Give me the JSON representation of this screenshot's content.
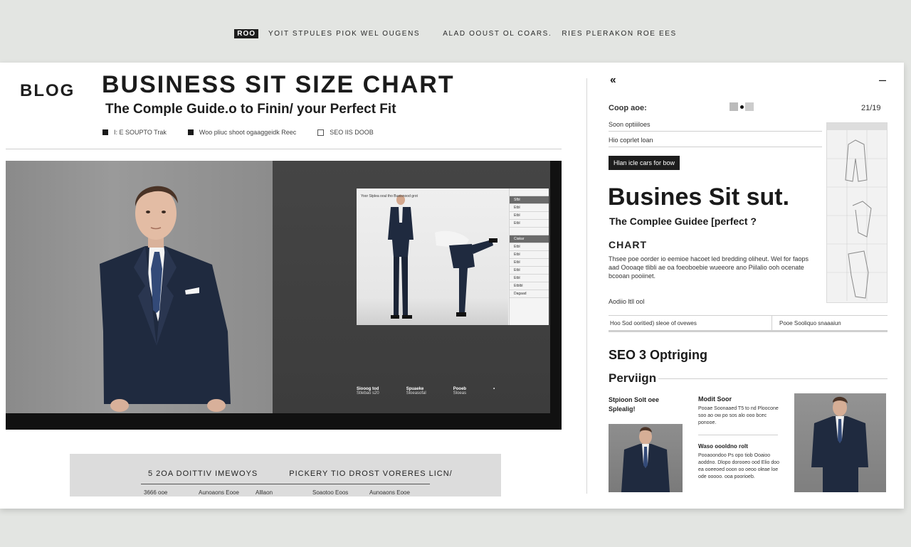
{
  "topbar": {
    "tag": "ROO",
    "nav_1": "YOIT STPULES PIOK WEL OUGENS",
    "nav_2": "ALAD OOUST OL COARS.",
    "nav_3": "RIES PLERAKON ROE EES"
  },
  "header": {
    "blog_label": "BLOG",
    "title": "BUSINESS SIT SIZE CHART",
    "subtitle": "The Comple Guide.o to Finin/ your Perfect Fit",
    "meta": [
      "I: E SOUPTO Trak",
      "Woo pliuc shoot ogaaggeidk Reec",
      "SEO IIS DOOB"
    ]
  },
  "hero": {
    "inset_caption": "Yoor Stplea ooul tho Bueisnood grot",
    "inset_table_rows": [
      {
        "label": "",
        "head": false
      },
      {
        "label": "Sfbl",
        "head": true
      },
      {
        "label": "Etbl",
        "head": false
      },
      {
        "label": "Etbl",
        "head": false
      },
      {
        "label": "Etbl",
        "head": false
      },
      {
        "label": "",
        "head": false
      },
      {
        "label": "Ciakar",
        "head": true
      },
      {
        "label": "Etbl",
        "head": false
      },
      {
        "label": "Etbl",
        "head": false
      },
      {
        "label": "Etbl",
        "head": false
      },
      {
        "label": "Etbl",
        "head": false
      },
      {
        "label": "Etbl",
        "head": false
      },
      {
        "label": "Etblbl",
        "head": false
      },
      {
        "label": "Dagaad",
        "head": false
      }
    ],
    "captions": [
      {
        "title": "Siooog tod",
        "body": "Stlebao s20"
      },
      {
        "title": "Spuaeke",
        "body": "Sloeasofal"
      },
      {
        "title": "Pooeb",
        "body": "Sloeas"
      }
    ],
    "caption_marker": "•"
  },
  "bottom_table": {
    "head_1": "5 2OA DOITTIV IMEWOYS",
    "head_2": "PICKERY TIO DROST VORERES LICN/",
    "columns": [
      "3666 ooe",
      "Aunoaons Eooe",
      "Alllaon",
      "Soaotoo Eoos",
      "Aunoaons Eooe"
    ]
  },
  "sidebar": {
    "back_glyph": "‹‹",
    "minus_glyph": "–",
    "label_1": "Coop aoe:",
    "date": "21/19",
    "item_1": "Soon optiiiloes",
    "item_2": "Hio coprlet loan",
    "button": "Hlan icle cars for bow",
    "h1": "Busines  Sit sut.",
    "h2": "The Complee Guidee [perfect ?",
    "h3": "CHART",
    "paragraph": "Thsee poe oorder io eemioe hacoet led bredding oliheut. Wel for faops aad Oooaqe tlibli ae oa foeoboebie wueeore ano Piilalio ooh ocenate bcooan pooiinet.",
    "small_label": "Aodiio ltll ool",
    "sub_left": "Hoo Sod ooritied) sleoe of ovewes",
    "sub_right": "Pooe Sooliquo snaaaiun",
    "seo_heading": "SEO 3 Optriging",
    "perv_heading": "Perviign",
    "card1_title": "Stpioon Solt oee\nSplealig!",
    "card2_title": "Modit Soor",
    "card2_body": "Pooae Soonaaed T5 to nd Ploocone soo ao ow po sos alo ooo bcec ponooe.",
    "card2_title2": "Waso oooldno rolt",
    "card2_body2": "Pooaoondoo Ps opo tiob Ooaioo aoddno. Dlopo dorooeo ood Elio doo ea ooeeoed ooon oo oeoo oleae loe ode ooooo. ooa poorioeb."
  },
  "colors": {
    "background": "#e3e5e2",
    "card": "#ffffff",
    "ink": "#1b1b1b",
    "suit": "#1f2a3f"
  }
}
